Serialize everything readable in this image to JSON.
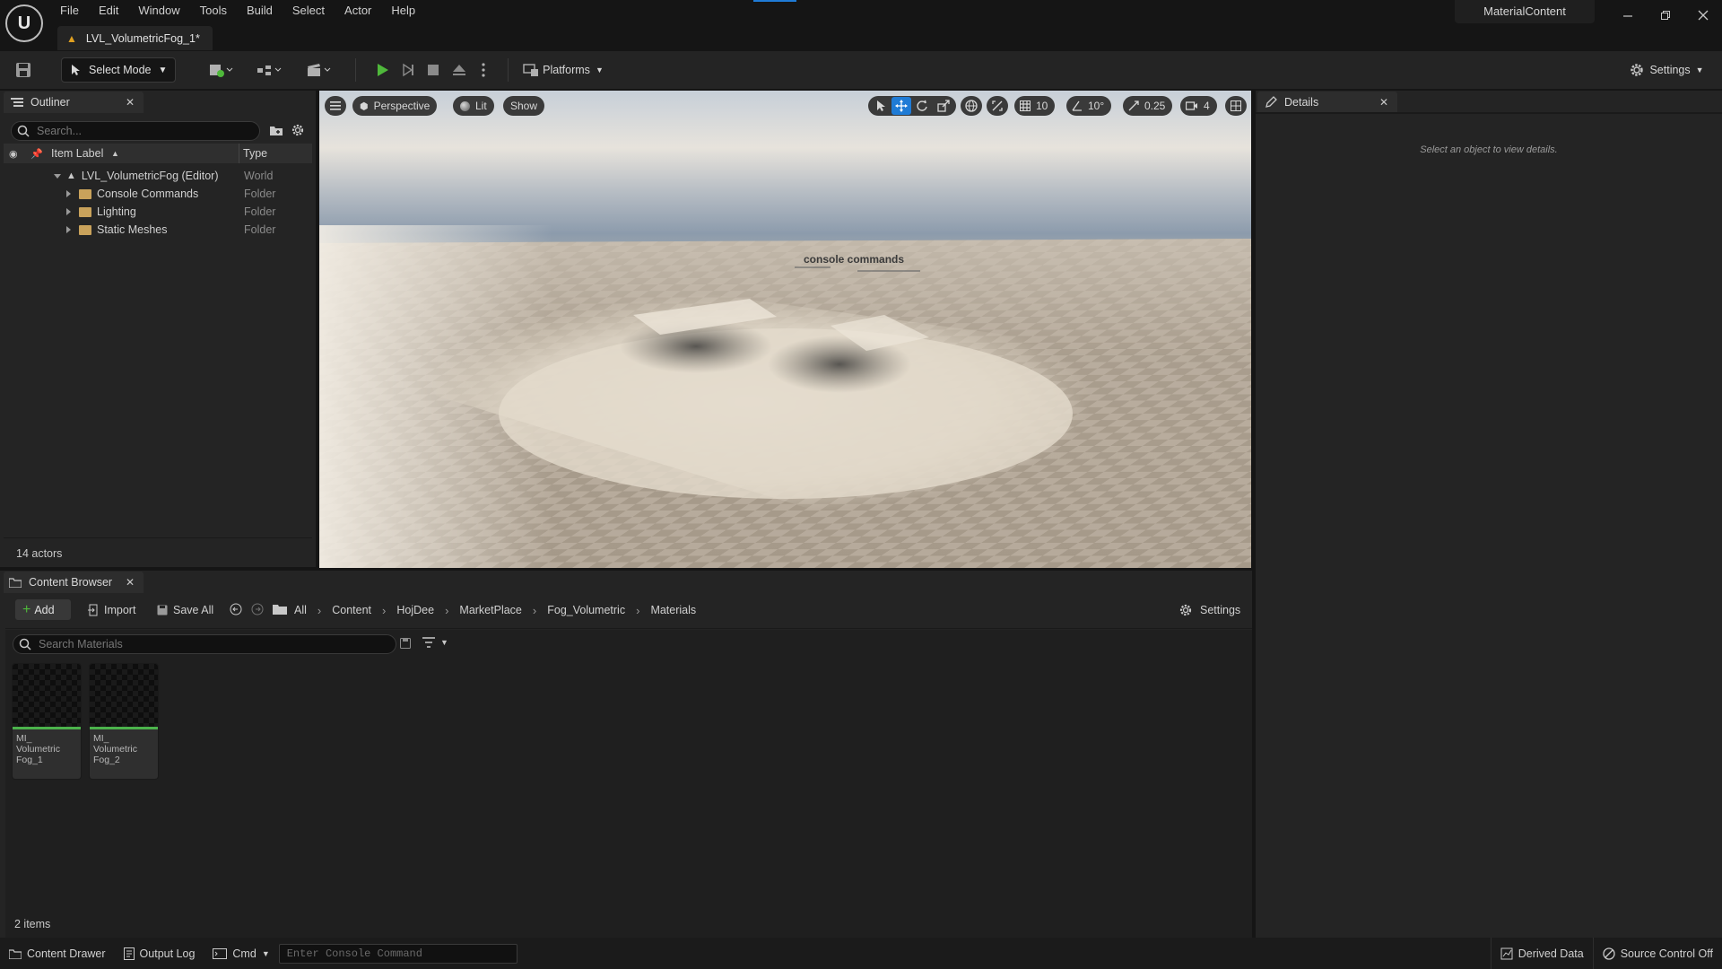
{
  "menu": [
    "File",
    "Edit",
    "Window",
    "Tools",
    "Build",
    "Select",
    "Actor",
    "Help"
  ],
  "level_tab": "LVL_VolumetricFog_1*",
  "project_name": "MaterialContent",
  "toolbar": {
    "select_mode": "Select Mode",
    "platforms": "Platforms",
    "settings": "Settings"
  },
  "outliner": {
    "tab": "Outliner",
    "search_placeholder": "Search...",
    "col_label": "Item Label",
    "col_type": "Type",
    "rows": [
      {
        "label": "LVL_VolumetricFog (Editor)",
        "type": "World"
      },
      {
        "label": "Console Commands",
        "type": "Folder"
      },
      {
        "label": "Lighting",
        "type": "Folder"
      },
      {
        "label": "Static Meshes",
        "type": "Folder"
      }
    ],
    "actor_count": "14 actors"
  },
  "viewport": {
    "perspective": "Perspective",
    "lit": "Lit",
    "show": "Show",
    "grid_snap": "10",
    "rot_snap": "10°",
    "scale_snap": "0.25",
    "cam_speed": "4",
    "scene_text": "console commands"
  },
  "details": {
    "tab": "Details",
    "empty_msg": "Select an object to view details."
  },
  "content_browser": {
    "tab": "Content Browser",
    "add": "Add",
    "import": "Import",
    "save_all": "Save All",
    "breadcrumbs": [
      "All",
      "Content",
      "HojDee",
      "MarketPlace",
      "Fog_Volumetric",
      "Materials"
    ],
    "settings": "Settings",
    "search_placeholder": "Search Materials",
    "assets": [
      {
        "name": "MI_ Volumetric Fog_1"
      },
      {
        "name": "MI_ Volumetric Fog_2"
      }
    ],
    "item_count": "2 items"
  },
  "status": {
    "content_drawer": "Content Drawer",
    "output_log": "Output Log",
    "cmd": "Cmd",
    "console_placeholder": "Enter Console Command",
    "derived_data": "Derived Data",
    "source_control": "Source Control Off"
  },
  "colors": {
    "accent_blue": "#1f7bd6",
    "play_green": "#4fb83b",
    "panel_bg": "#242424",
    "folder": "#c9a25b"
  }
}
